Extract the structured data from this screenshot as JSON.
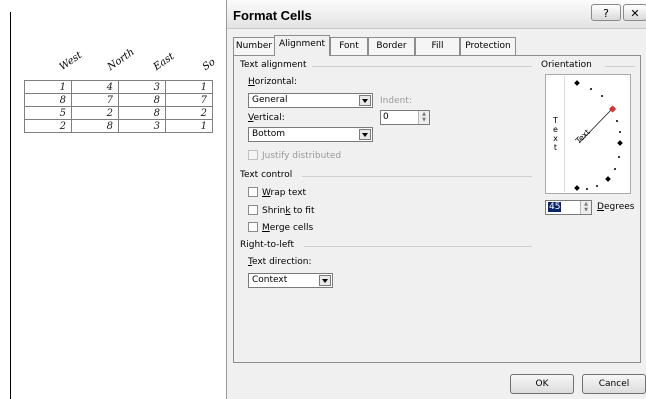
{
  "sheet": {
    "headers": [
      "West",
      "North",
      "East",
      "So"
    ],
    "rows": [
      [
        "1",
        "4",
        "3",
        "1"
      ],
      [
        "8",
        "7",
        "8",
        "7"
      ],
      [
        "5",
        "2",
        "8",
        "2"
      ],
      [
        "2",
        "8",
        "3",
        "1"
      ]
    ]
  },
  "dialog": {
    "title": "Format Cells",
    "help_label": "?",
    "close_label": "✕",
    "tabs": [
      "Number",
      "Alignment",
      "Font",
      "Border",
      "Fill",
      "Protection"
    ],
    "active_tab": "Alignment",
    "text_alignment": {
      "section": "Text alignment",
      "horizontal_label": "Horizontal:",
      "horizontal_value": "General",
      "indent_label": "Indent:",
      "indent_value": "0",
      "vertical_label": "Vertical:",
      "vertical_value": "Bottom",
      "justify_label": "Justify distributed"
    },
    "text_control": {
      "section": "Text control",
      "wrap": "Wrap text",
      "shrink": "Shrink to fit",
      "merge": "Merge cells"
    },
    "rtl": {
      "section": "Right-to-left",
      "direction_label": "Text direction:",
      "direction_value": "Context"
    },
    "orientation": {
      "section": "Orientation",
      "vertical_letters": [
        "T",
        "e",
        "x",
        "t"
      ],
      "dial_text": "Text",
      "degrees_value": "45",
      "degrees_label": "Degrees"
    },
    "ok_label": "OK",
    "cancel_label": "Cancel"
  }
}
